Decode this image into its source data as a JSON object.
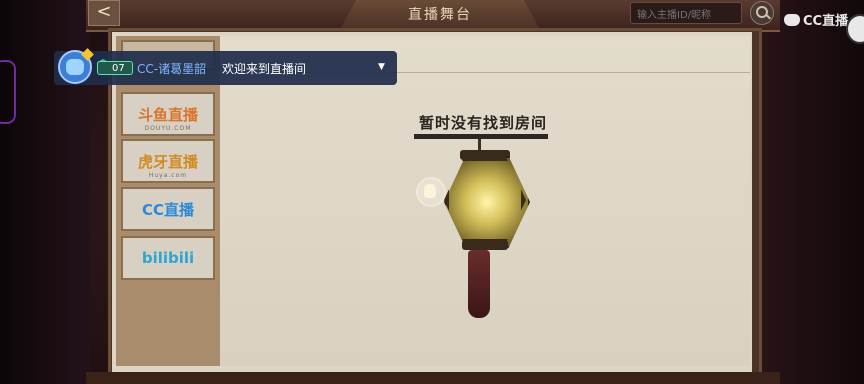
{
  "header": {
    "title": "直播舞台",
    "back_label": "<",
    "search_placeholder": "输入主播ID/昵称"
  },
  "watermark": {
    "text": "CC直播"
  },
  "tabs": [
    {
      "label": "",
      "sub": ""
    },
    {
      "label": "斗鱼直播",
      "sub": "DOUYU.COM"
    },
    {
      "label": "虎牙直播",
      "sub": "Huya.com"
    },
    {
      "label": "CC直播",
      "sub": ""
    },
    {
      "label": "bilibili",
      "sub": ""
    }
  ],
  "chat": {
    "level": "07",
    "user": "CC-诸葛墨韶",
    "message": "欢迎来到直播间",
    "dropdown": "▼"
  },
  "main": {
    "empty_message": "暂时没有找到房间"
  },
  "colors": {
    "douyu": "#d9752c",
    "huya": "#d48a22",
    "cc": "#2d8ad8",
    "bilibili": "#2fa5d6",
    "chat_user": "#7fb6ff",
    "level_badge": "#35c89a"
  },
  "icons": {
    "back": "arrow-left-icon",
    "search": "magnifier-icon",
    "lantern": "lantern-illustration",
    "cursor": "hand-pointer-icon"
  }
}
